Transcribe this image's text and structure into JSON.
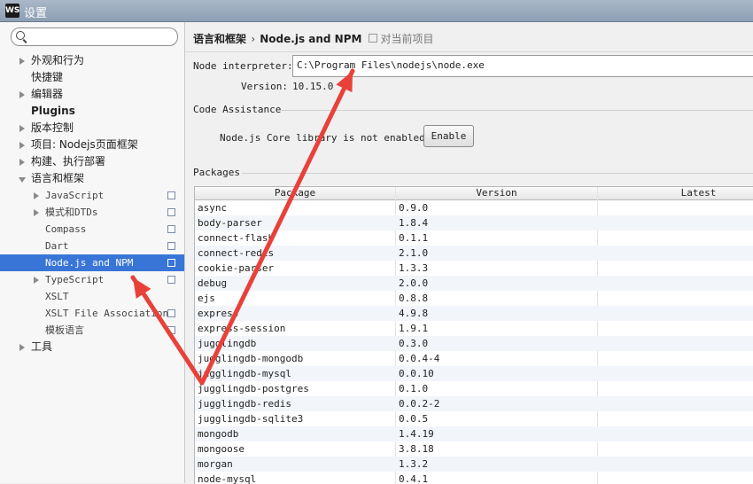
{
  "window": {
    "title": "设置",
    "icon_label": "WS"
  },
  "search": {
    "placeholder": ""
  },
  "tree": [
    {
      "label": "外观和行为",
      "level": 0,
      "arrow": "right",
      "copy": false
    },
    {
      "label": "快捷键",
      "level": 0,
      "arrow": "none",
      "copy": false
    },
    {
      "label": "编辑器",
      "level": 0,
      "arrow": "right",
      "copy": false
    },
    {
      "label": "Plugins",
      "level": 0,
      "arrow": "none",
      "copy": false,
      "bold": true
    },
    {
      "label": "版本控制",
      "level": 0,
      "arrow": "right",
      "copy": false
    },
    {
      "label": "项目: Nodejs页面框架",
      "level": 0,
      "arrow": "right",
      "copy": false
    },
    {
      "label": "构建、执行部署",
      "level": 0,
      "arrow": "right",
      "copy": false
    },
    {
      "label": "语言和框架",
      "level": 0,
      "arrow": "down",
      "copy": false
    },
    {
      "label": "JavaScript",
      "level": 1,
      "arrow": "right",
      "copy": true
    },
    {
      "label": "模式和DTDs",
      "level": 1,
      "arrow": "right",
      "copy": true
    },
    {
      "label": "Compass",
      "level": 1,
      "arrow": "none",
      "copy": true
    },
    {
      "label": "Dart",
      "level": 1,
      "arrow": "none",
      "copy": true
    },
    {
      "label": "Node.js and NPM",
      "level": 1,
      "arrow": "none",
      "copy": true,
      "selected": true
    },
    {
      "label": "TypeScript",
      "level": 1,
      "arrow": "right",
      "copy": true
    },
    {
      "label": "XSLT",
      "level": 1,
      "arrow": "none",
      "copy": false
    },
    {
      "label": "XSLT File Associations",
      "level": 1,
      "arrow": "none",
      "copy": true
    },
    {
      "label": "模板语言",
      "level": 1,
      "arrow": "none",
      "copy": true
    },
    {
      "label": "工具",
      "level": 0,
      "arrow": "right",
      "copy": false
    }
  ],
  "breadcrumb": {
    "parent": "语言和框架",
    "separator": "›",
    "current": "Node.js and NPM",
    "scope": "对当前项目"
  },
  "interpreter": {
    "label": "Node interpreter:",
    "value": "C:\\Program Files\\nodejs\\node.exe",
    "version_label": "Version:",
    "version": "10.15.0"
  },
  "code_assistance": {
    "title": "Code Assistance",
    "message": "Node.js Core library is not enabled.",
    "button": "Enable"
  },
  "packages": {
    "title": "Packages",
    "columns": [
      "Package",
      "Version",
      "Latest"
    ],
    "rows": [
      [
        "async",
        "0.9.0",
        ""
      ],
      [
        "body-parser",
        "1.8.4",
        ""
      ],
      [
        "connect-flash",
        "0.1.1",
        ""
      ],
      [
        "connect-redis",
        "2.1.0",
        ""
      ],
      [
        "cookie-parser",
        "1.3.3",
        ""
      ],
      [
        "debug",
        "2.0.0",
        ""
      ],
      [
        "ejs",
        "0.8.8",
        ""
      ],
      [
        "express",
        "4.9.8",
        ""
      ],
      [
        "express-session",
        "1.9.1",
        ""
      ],
      [
        "jugglingdb",
        "0.3.0",
        ""
      ],
      [
        "jugglingdb-mongodb",
        "0.0.4-4",
        ""
      ],
      [
        "jugglingdb-mysql",
        "0.0.10",
        ""
      ],
      [
        "jugglingdb-postgres",
        "0.1.0",
        ""
      ],
      [
        "jugglingdb-redis",
        "0.0.2-2",
        ""
      ],
      [
        "jugglingdb-sqlite3",
        "0.0.5",
        ""
      ],
      [
        "mongodb",
        "1.4.19",
        ""
      ],
      [
        "mongoose",
        "3.8.18",
        ""
      ],
      [
        "morgan",
        "1.3.2",
        ""
      ],
      [
        "node-mysql",
        "0.4.1",
        ""
      ]
    ]
  },
  "annotation_color": "#e8413a"
}
